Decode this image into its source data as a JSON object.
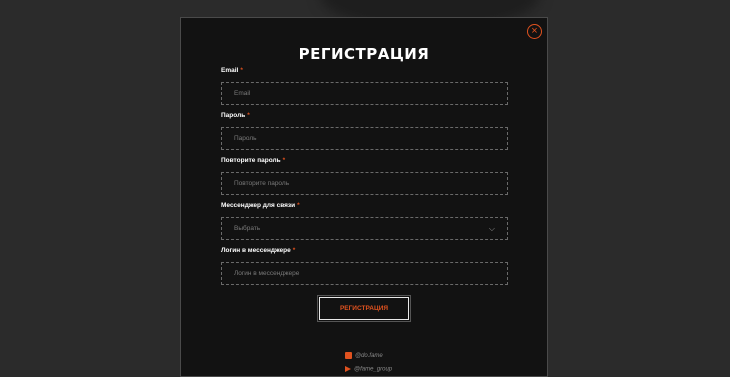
{
  "modal": {
    "title": "РЕГИСТРАЦИЯ",
    "close_icon": "×",
    "required_mark": "*",
    "fields": [
      {
        "label": "Email",
        "placeholder": "Email"
      },
      {
        "label": "Пароль",
        "placeholder": "Пароль"
      },
      {
        "label": "Повторите пароль",
        "placeholder": "Повторите пароль"
      },
      {
        "label": "Мессенджер для связи",
        "placeholder": "Выбрать"
      },
      {
        "label": "Логин в мессенджере",
        "placeholder": "Логин в мессенджере"
      }
    ],
    "submit_label": "РЕГИСТРАЦИЯ",
    "socials": [
      {
        "text": "@do.fame",
        "icon": "instagram-icon"
      },
      {
        "text": "@fame_group",
        "icon": "telegram-icon"
      }
    ]
  },
  "colors": {
    "accent": "#e0521f",
    "modal_bg": "#121212",
    "page_bg": "#2b2b2b"
  }
}
